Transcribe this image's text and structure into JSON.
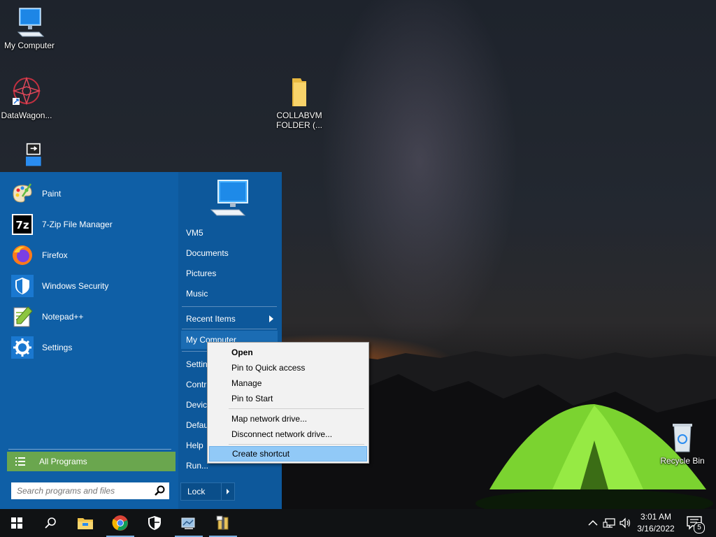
{
  "desktop": {
    "icons": [
      {
        "label": "My Computer"
      },
      {
        "label": "DataWagon..."
      },
      {
        "label": "COLLABVM FOLDER (..."
      },
      {
        "label": "Recycle Bin"
      }
    ]
  },
  "start_menu": {
    "programs": [
      {
        "label": "Paint",
        "icon": "paint-icon"
      },
      {
        "label": "7-Zip File Manager",
        "icon": "7zip-icon"
      },
      {
        "label": "Firefox",
        "icon": "firefox-icon"
      },
      {
        "label": "Windows Security",
        "icon": "shield-icon"
      },
      {
        "label": "Notepad++",
        "icon": "notepadpp-icon"
      },
      {
        "label": "Settings",
        "icon": "gear-icon"
      }
    ],
    "all_programs_label": "All Programs",
    "search_placeholder": "Search programs and files",
    "right_items": [
      {
        "label": "VM5"
      },
      {
        "label": "Documents"
      },
      {
        "label": "Pictures"
      },
      {
        "label": "Music"
      },
      {
        "label": "Recent Items"
      },
      {
        "label": "My Computer"
      },
      {
        "label": "Settin"
      },
      {
        "label": "Contr"
      },
      {
        "label": "Devic"
      },
      {
        "label": "Defau"
      },
      {
        "label": "Help"
      },
      {
        "label": "Run..."
      }
    ],
    "lock_label": "Lock"
  },
  "context_menu": {
    "items": [
      {
        "label": "Open"
      },
      {
        "label": "Pin to Quick access"
      },
      {
        "label": "Manage"
      },
      {
        "label": "Pin to Start"
      },
      {
        "label": "Map network drive..."
      },
      {
        "label": "Disconnect network drive..."
      },
      {
        "label": "Create shortcut"
      }
    ]
  },
  "taskbar": {
    "time": "3:01 AM",
    "date": "3/16/2022",
    "notification_count": "5"
  },
  "colors": {
    "start_menu_blue": "#0f5fa6",
    "all_programs_green": "#6aa64e",
    "context_highlight": "#91c9f7"
  }
}
